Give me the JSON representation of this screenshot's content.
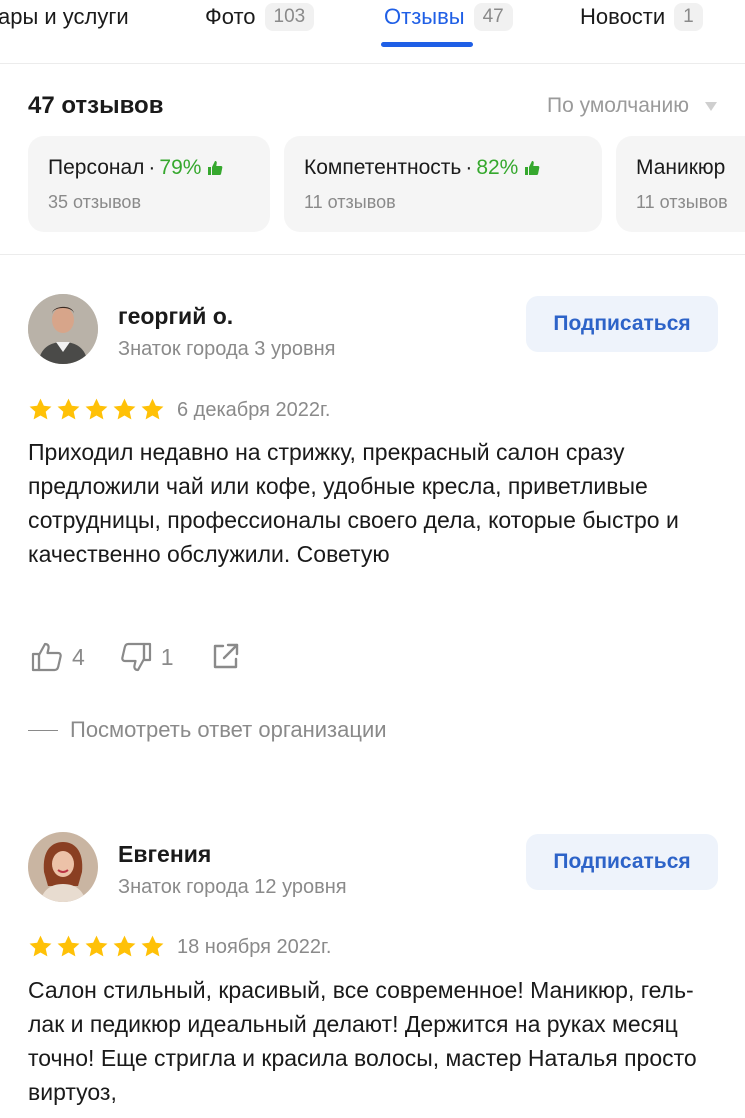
{
  "tabs": [
    {
      "label": "ары и услуги",
      "count": ""
    },
    {
      "label": "Фото",
      "count": "103"
    },
    {
      "label": "Отзывы",
      "count": "47"
    },
    {
      "label": "Новости",
      "count": "1"
    }
  ],
  "header": {
    "reviews_count": "47 отзывов",
    "sort_label": "По умолчанию"
  },
  "aspects": [
    {
      "name": "Персонал",
      "sep": "·",
      "percent": "79%",
      "reviews": "35 отзывов"
    },
    {
      "name": "Компетентность",
      "sep": "·",
      "percent": "82%",
      "reviews": "11 отзывов"
    },
    {
      "name": "Маникюр",
      "sep": "",
      "percent": "",
      "reviews": "11 отзывов"
    }
  ],
  "reviews": [
    {
      "author": "георгий о.",
      "level": "Знаток города 3 уровня",
      "subscribe_label": "Подписаться",
      "rating": 5,
      "date": "6 декабря 2022г.",
      "text": "Приходил недавно на стрижку, прекрасный салон сразу предложили чай или кофе, удобные кресла, приветливые сотрудницы, профессионалы своего дела, которые быстро и качественно обслужили. Советую",
      "likes": "4",
      "dislikes": "1",
      "org_reply_label": "Посмотреть ответ организации"
    },
    {
      "author": "Евгения",
      "level": "Знаток города 12 уровня",
      "subscribe_label": "Подписаться",
      "rating": 5,
      "date": "18 ноября 2022г.",
      "text": "Салон стильный, красивый, все современное! Маникюр, гель-лак и педикюр идеальный делают! Держится на руках месяц точно! Еще стригла и красила волосы, мастер Наталья просто виртуоз,"
    }
  ],
  "colors": {
    "accent": "#1f5fe6",
    "positive": "#36a82e",
    "star": "#ffc107",
    "muted": "#8a8a8a"
  },
  "icons": [
    "thumb-up-icon",
    "thumb-down-icon",
    "share-icon",
    "star-icon",
    "sort-arrow-icon"
  ]
}
